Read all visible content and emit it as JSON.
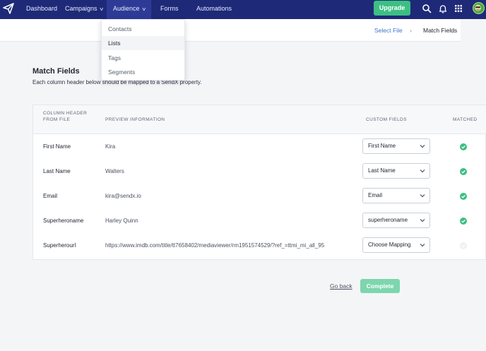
{
  "nav": {
    "items": [
      {
        "label": "Dashboard",
        "has_caret": false
      },
      {
        "label": "Campaigns",
        "has_caret": true
      },
      {
        "label": "Audience",
        "has_caret": true,
        "active": true
      },
      {
        "label": "Forms",
        "has_caret": false
      },
      {
        "label": "Automations",
        "has_caret": false
      }
    ],
    "upgrade_label": "Upgrade",
    "icons": [
      "search-icon",
      "bell-icon",
      "apps-grid-icon"
    ],
    "accent": "#1e2a78",
    "upgrade_color": "#3dbf84"
  },
  "audience_menu": {
    "items": [
      "Contacts",
      "Lists",
      "Tags",
      "Segments"
    ],
    "hovered": "Lists"
  },
  "breadcrumb": {
    "link": "Select File",
    "separator": "›",
    "current": "Match Fields"
  },
  "page": {
    "title": "Match Fields",
    "description": "Each column header below should be mapped to a SendX property."
  },
  "table": {
    "headers": {
      "column_header": "COLUMN HEADER FROM FILE",
      "preview": "PREVIEW INFORMATION",
      "custom_fields": "CUSTOM FIELDS",
      "matched": "MATCHED"
    },
    "rows": [
      {
        "column": "First Name",
        "preview": "Kira",
        "field": "First Name",
        "matched": true
      },
      {
        "column": "Last Name",
        "preview": "Walters",
        "field": "Last Name",
        "matched": true
      },
      {
        "column": "Email",
        "preview": "kira@sendx.io",
        "field": "Email",
        "matched": true
      },
      {
        "column": "Superheroname",
        "preview": "Harley Quinn",
        "field": "superheroname",
        "matched": true
      },
      {
        "column": "Superherourl",
        "preview": "https://www.imdb.com/title/tt7658402/mediaviewer/rm1951574529/?ref_=ttmi_mi_all_95",
        "field": "Choose Mapping",
        "matched": false
      }
    ],
    "matched_color": "#3dbf84"
  },
  "actions": {
    "back_label": "Go back",
    "complete_label": "Complete",
    "complete_color": "#7dd6ad"
  }
}
